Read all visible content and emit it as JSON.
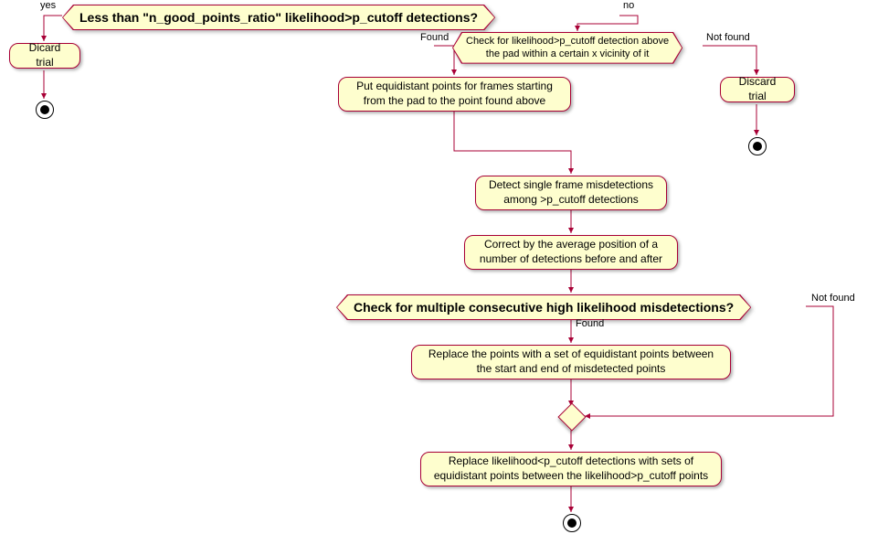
{
  "decisions": {
    "d1": "Less than \"n_good_points_ratio\" likelihood>p_cutoff detections?",
    "d1_yes": "yes",
    "d1_no": "no",
    "d2_line1": "Check for likelihood>p_cutoff detection above",
    "d2_line2": "the pad within a certain x vicinity of it",
    "d2_found": "Found",
    "d2_notfound": "Not found",
    "d3": "Check for multiple consecutive high likelihood misdetections?",
    "d3_found": "Found",
    "d3_notfound": "Not found"
  },
  "actions": {
    "discard_left": "Dicard trial",
    "discard_right": "Discard trial",
    "put_equidistant_line1": "Put equidistant points for frames starting",
    "put_equidistant_line2": "from the pad to the point found above",
    "detect_single_line1": "Detect single frame misdetections",
    "detect_single_line2": "among >p_cutoff detections",
    "correct_avg_line1": "Correct by the average position of a",
    "correct_avg_line2": "number of detections before and after",
    "replace_set_line1": "Replace the points with a set of equidistant points between",
    "replace_set_line2": "the start and end of misdetected points",
    "replace_likelihood_line1": "Replace likelihood<p_cutoff detections with sets of",
    "replace_likelihood_line2": "equidistant points between the likelihood>p_cutoff points"
  }
}
